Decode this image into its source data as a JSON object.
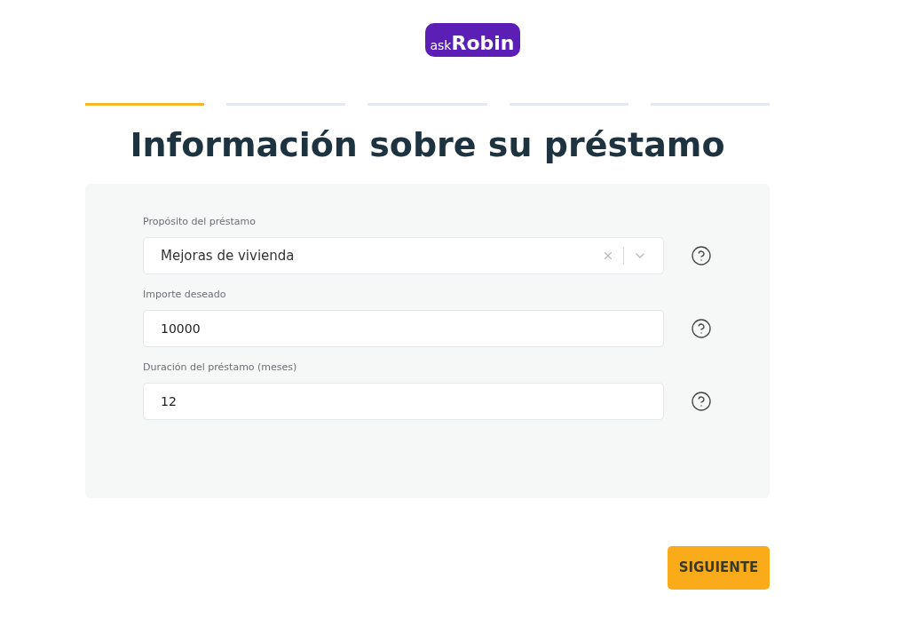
{
  "logo": {
    "prefix": "ask",
    "name": "Robin"
  },
  "steps": [
    {
      "selected": true
    },
    {
      "selected": false
    },
    {
      "selected": false
    },
    {
      "selected": false
    },
    {
      "selected": false
    }
  ],
  "title": "Información sobre su préstamo",
  "fields": [
    {
      "kind": "select",
      "label": "Propósito del préstamo",
      "value": "Mejoras de vivienda"
    },
    {
      "kind": "text",
      "label": "Importe deseado",
      "value": "10000"
    },
    {
      "kind": "text",
      "label": "Duración del préstamo (meses)",
      "value": "12"
    }
  ],
  "next_button": "SIGUIENTE"
}
